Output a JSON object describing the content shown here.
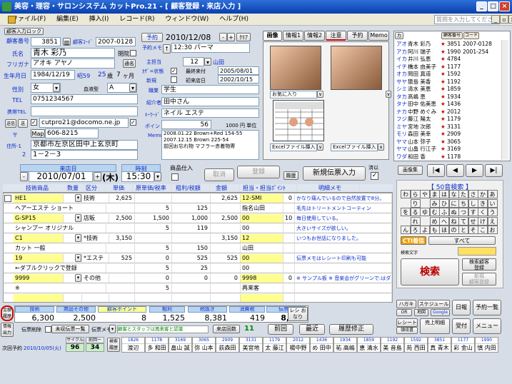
{
  "window": {
    "title": "美容・理容・サロンシステム カットPro.21 - [ 顧客登録・来店入力 ]"
  },
  "menu": {
    "items": [
      "ファイル(F)",
      "編集(E)",
      "挿入(I)",
      "レコード(R)",
      "ウィンドウ(W)",
      "ヘルプ(H)"
    ],
    "help_placeholder": "質問を入力してください"
  },
  "customer": {
    "card_label": "顧客入力ロック",
    "no_label": "顧客番号",
    "no": "3851",
    "code_label": "顧客ｺｰﾄﾞ",
    "code": "2007-0128",
    "name_label": "氏名",
    "name": "青木 彩乃",
    "kana_label": "フリガナ",
    "kana": "アオキ アヤノ",
    "closed_label": "閉院",
    "nickname_btn": "通名",
    "dob_label": "生年月日",
    "dob": "1984/12/19",
    "era": "昭59",
    "age": "25",
    "age_unit": "歳",
    "month": "7",
    "month_unit": "ヶ月",
    "sex_label": "性別",
    "sex": "女",
    "blood_label": "血液型",
    "blood": "A",
    "tel_label": "TEL",
    "tel": "0751234567",
    "mobile_label": "携帯TEL",
    "mobile": "",
    "email_btn1": "送信",
    "email_btn2": "送",
    "email": "cutpro21@docomo.ne.jp",
    "zip_label": "〒",
    "map_btn": "Map",
    "zip": "606-8215",
    "addr_label1": "住所-1",
    "addr1": "京都市左京区田中上玄京町",
    "addr_label2": "2",
    "addr2": "1－2－3"
  },
  "middle": {
    "reserve_btn": "予約",
    "reserve_date": "2010/12/08",
    "plus": "+",
    "minus": "-",
    "clear": "ｸﾘｱ",
    "memo_label": "予約メモ",
    "memo_btn": "↑",
    "memo": "12:30 パーマ",
    "staff_label": "主担当",
    "staff_no": "12",
    "staff": "山田",
    "hairdress_label": "ｶｻﾞ=状態",
    "hairdress_check": "最終来付",
    "hairdress_date": "2005/08/01",
    "newflag_label": "新規",
    "first_label": "初来店日",
    "first_date": "2002/10/15",
    "job_label": "職業",
    "job": "学生",
    "intro_label": "紹介者",
    "intro": "田中さん",
    "keyword_label": "ｷｰﾜｰﾄﾞ",
    "keyword": "ネイル エステ",
    "point_label": "ポイント",
    "point": "56",
    "point_rate": "1000 円 単位",
    "memo2_label": "Memo",
    "memo2": [
      "2008.01.22 Brown+Red 154-55",
      "",
      "2007.12.15 Brown 225-54",
      "前回お忘れ物 マフラー赤着物寄"
    ]
  },
  "tabs": {
    "items": [
      "画像",
      "情報1",
      "情報2",
      "注意",
      "予約",
      "Memo"
    ],
    "active": "画像"
  },
  "images": {
    "fav_label": "お気に入り",
    "excel1": "Excelファイル挿入",
    "excel2": "Excelファイル挿入",
    "hint": "∨"
  },
  "visit": {
    "date_label": "来店日",
    "date": "2010/07/01",
    "weekday": "(木)",
    "time_label": "時刻",
    "time": "15:30",
    "product_label": "商品仕入",
    "cancel": "取消",
    "register": "登録",
    "history": "履歴",
    "new_slip": "新規伝票入力",
    "done": "済以"
  },
  "grid": {
    "headers": [
      "技術商品",
      "数量",
      "区分",
      "単価",
      "原単価/税率",
      "粗利/税額",
      "金額",
      "担当・担当ﾎﾟｲﾝﾄ",
      "明細メモ"
    ],
    "rows": [
      {
        "code": "HE1",
        "qty": "1",
        "kind": "技術",
        "price": "2,625",
        "cost": "",
        "gross": "",
        "amount": "2,625",
        "staff": "12-SMI",
        "c": "0",
        "memo": "かなり痛んでいるので自然放置で8分。"
      },
      {
        "code": "ヘアーエステ ショート",
        "qty": "",
        "kind": "",
        "price": "",
        "cost": "5",
        "gross": "125",
        "amount": "",
        "staff": "指名山田",
        "c": "",
        "memo": "毛先はトリートメントコーティン"
      },
      {
        "code": "G-SP15",
        "qty": "1",
        "kind": "店販",
        "price": "2,500",
        "cost": "1,500",
        "gross": "1,000",
        "amount": "2,500",
        "staff": "00",
        "c": "10",
        "memo": "毎日使用している。"
      },
      {
        "code": "シャンプー オリジナル",
        "qty": "",
        "kind": "",
        "price": "",
        "cost": "5",
        "gross": "119",
        "amount": "",
        "staff": "00",
        "c": "",
        "memo": "大きいサイズが欲しい。"
      },
      {
        "code": "C1",
        "qty": "1",
        "kind": "*技術",
        "price": "3,150",
        "cost": "",
        "gross": "",
        "amount": "3,150",
        "staff": "12",
        "c": "",
        "memo": "いつもお世話になりました。"
      },
      {
        "code": "カット 一般",
        "qty": "",
        "kind": "",
        "price": "",
        "cost": "5",
        "gross": "150",
        "amount": "",
        "staff": "山田",
        "c": "",
        "memo": ""
      },
      {
        "code": "19",
        "qty": "1",
        "kind": "*エステ",
        "price": "525",
        "cost": "0",
        "gross": "525",
        "amount": "525",
        "staff": "00",
        "c": "",
        "memo": "伝票メモはレシート印刷も可能"
      },
      {
        "code": "←ダブルクリックで登録",
        "qty": "",
        "kind": "",
        "price": "",
        "cost": "5",
        "gross": "25",
        "amount": "",
        "staff": "00",
        "c": "",
        "memo": ""
      },
      {
        "code": "9999",
        "qty": "1",
        "kind": "その他",
        "price": "",
        "cost": "0",
        "gross": "0",
        "amount": "0",
        "staff": "9998",
        "c": "0",
        "memo": "※ サンプル板 ※ 音楽会がグリーンで:はダブルクリックで情報もよびだします。"
      },
      {
        "code": "※",
        "qty": "",
        "kind": "",
        "price": "",
        "cost": "5",
        "gross": "",
        "amount": "",
        "staff": "再来客",
        "c": "",
        "memo": ""
      },
      {
        "code": "",
        "qty": "",
        "kind": "",
        "price": "",
        "cost": "",
        "gross": "",
        "amount": "",
        "staff": "",
        "c": "",
        "memo": ""
      }
    ]
  },
  "totals": {
    "tech_label": "技術",
    "tech": "6,300",
    "goods_label": "商品その他",
    "goods": "2,500",
    "cust_point_label": "顧客ポイント",
    "cust_point": "8",
    "gross_label": "粗利",
    "gross": "1,525",
    "before_tax_label": "税抜き",
    "before_tax": "8,381",
    "tax_label": "消費税",
    "tax": "419",
    "slip_total_label": "伝票計",
    "slip_total": "8,800",
    "receipt_label": "レシ\nおなり"
  },
  "footer": {
    "slip_delete": "伝票削除",
    "pay_type": "未収伝票一覧",
    "slip_memo_label": "伝票メモ",
    "slip_memo": "顧客とスタッフは再来客と認識",
    "visit_count_label": "来店回数",
    "visit_count": "11",
    "prev": "前回",
    "latest": "最近",
    "history_fix": "履歴修正",
    "next_reserve_label": "次回予約",
    "next_reserve": "2010/10/05(火)",
    "cycle_label": "サイクル",
    "cycle": "96",
    "cycle2_label": "前回ー",
    "cycle2": "34",
    "left_btn1": "金額\n履歴",
    "left_btn2": "情報\n出力"
  },
  "bottom_customers": [
    {
      "no": "1826",
      "name": "渡辺"
    },
    {
      "no": "1178",
      "name": "多 和田"
    },
    {
      "no": "3169",
      "name": "畠山 誠"
    },
    {
      "no": "3065",
      "name": "弥 山本"
    },
    {
      "no": "2909",
      "name": "荻森田"
    },
    {
      "no": "3131",
      "name": "美宮地"
    },
    {
      "no": "1179",
      "name": "太 藤江"
    },
    {
      "no": "2012",
      "name": "楊中野"
    },
    {
      "no": "1436",
      "name": "め 田中"
    },
    {
      "no": "1934",
      "name": "祐 高嶋"
    },
    {
      "no": "1859",
      "name": "恵 清水"
    },
    {
      "no": "1192",
      "name": "美 音島"
    },
    {
      "no": "1592",
      "name": "苑 西田"
    },
    {
      "no": "3851",
      "name": "真 青木"
    },
    {
      "no": "1177",
      "name": "彩 金山"
    },
    {
      "no": "1990",
      "name": "慎 内田"
    }
  ],
  "side": {
    "label_card": "カ",
    "header1": "顧客番号",
    "header2": "コード",
    "list": [
      {
        "kana": "アオ",
        "name": "青木 彩乃",
        "star": "★",
        "no": "3851",
        "code": "2007-0128"
      },
      {
        "kana": "アカ",
        "name": "阿川 瑞子",
        "star": "★",
        "no": "1990",
        "code": "2001-254"
      },
      {
        "kana": "イカ",
        "name": "井川 弘恵",
        "star": "★",
        "no": "4784",
        "code": ""
      },
      {
        "kana": "イチ",
        "name": "橋本 由美子",
        "star": "★",
        "no": "1177",
        "code": ""
      },
      {
        "kana": "オカ",
        "name": "岡田 真道",
        "star": "★",
        "no": "1592",
        "code": ""
      },
      {
        "kana": "サヤ",
        "name": "猿島 美香",
        "star": "★",
        "no": "1192",
        "code": ""
      },
      {
        "kana": "シミ",
        "name": "清水 美恵",
        "star": "★",
        "no": "1859",
        "code": ""
      },
      {
        "kana": "タカ",
        "name": "高嶋 恵",
        "star": "★",
        "no": "1934",
        "code": ""
      },
      {
        "kana": "タナ",
        "name": "田中 佑美恵",
        "star": "★",
        "no": "1436",
        "code": ""
      },
      {
        "kana": "ナカ",
        "name": "中野 めぐみ",
        "star": "★",
        "no": "2012",
        "code": ""
      },
      {
        "kana": "フジ",
        "name": "藤江 陽太",
        "star": "★",
        "no": "1179",
        "code": ""
      },
      {
        "kana": "ミヤ",
        "name": "宮地 次郎",
        "star": "★",
        "no": "3131",
        "code": ""
      },
      {
        "kana": "モリ",
        "name": "森田 美幸",
        "star": "★",
        "no": "2909",
        "code": ""
      },
      {
        "kana": "ヤマ",
        "name": "山本 弥子",
        "star": "★",
        "no": "3065",
        "code": ""
      },
      {
        "kana": "ヤマ",
        "name": "山畠 行江子",
        "star": "★",
        "no": "3169",
        "code": ""
      },
      {
        "kana": "ワダ",
        "name": "和田 香",
        "star": "★",
        "no": "1178",
        "code": ""
      }
    ],
    "image_btn": "画像集",
    "kana_title": "【 50音検索 】",
    "kana_rows": [
      [
        "わ",
        "ら",
        "や",
        "ま",
        "は",
        "な",
        "た",
        "さ",
        "か",
        "あ"
      ],
      [
        "",
        "り",
        "",
        "み",
        "ひ",
        "に",
        "ち",
        "し",
        "き",
        "い"
      ],
      [
        "を",
        "る",
        "ゆ",
        "む",
        "ふ",
        "ぬ",
        "つ",
        "す",
        "く",
        "う"
      ],
      [
        "",
        "れ",
        "",
        "め",
        "へ",
        "ね",
        "て",
        "せ",
        "け",
        "え"
      ],
      [
        "ん",
        "ろ",
        "よ",
        "も",
        "ほ",
        "の",
        "と",
        "そ",
        "こ",
        "お"
      ]
    ],
    "cti": "CTI着信",
    "all": "すべて",
    "search_label": "検索文字",
    "search": "検索",
    "hist_search": "検索顧客\n登録",
    "new_cust": "新規\n顧客登録",
    "b_buttons": [
      "ハガキ",
      "スケジュール",
      "日報",
      "予約一覧",
      "OR",
      "地図",
      "Google",
      "レシート",
      "売上明細",
      "受付",
      "メニュー",
      "領収書"
    ]
  }
}
